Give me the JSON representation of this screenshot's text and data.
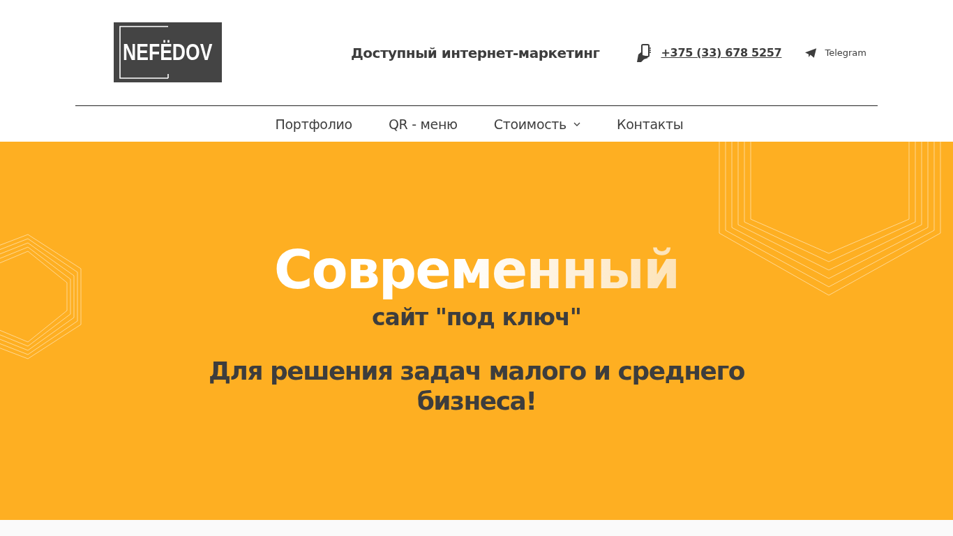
{
  "header": {
    "logo": "NEFЁDOV",
    "tagline": "Доступный интернет-маркетинг",
    "phone": "+375 (33) 678 5257",
    "telegram": "Telegram"
  },
  "nav": [
    {
      "label": "Портфолио",
      "dropdown": false
    },
    {
      "label": "QR - меню",
      "dropdown": false
    },
    {
      "label": "Стоимость",
      "dropdown": true
    },
    {
      "label": "Контакты",
      "dropdown": false
    }
  ],
  "hero": {
    "title": "Современный",
    "subtitle": "сайт \"под ключ\"",
    "text": "Для решения задач малого и среднего бизнеса!"
  }
}
